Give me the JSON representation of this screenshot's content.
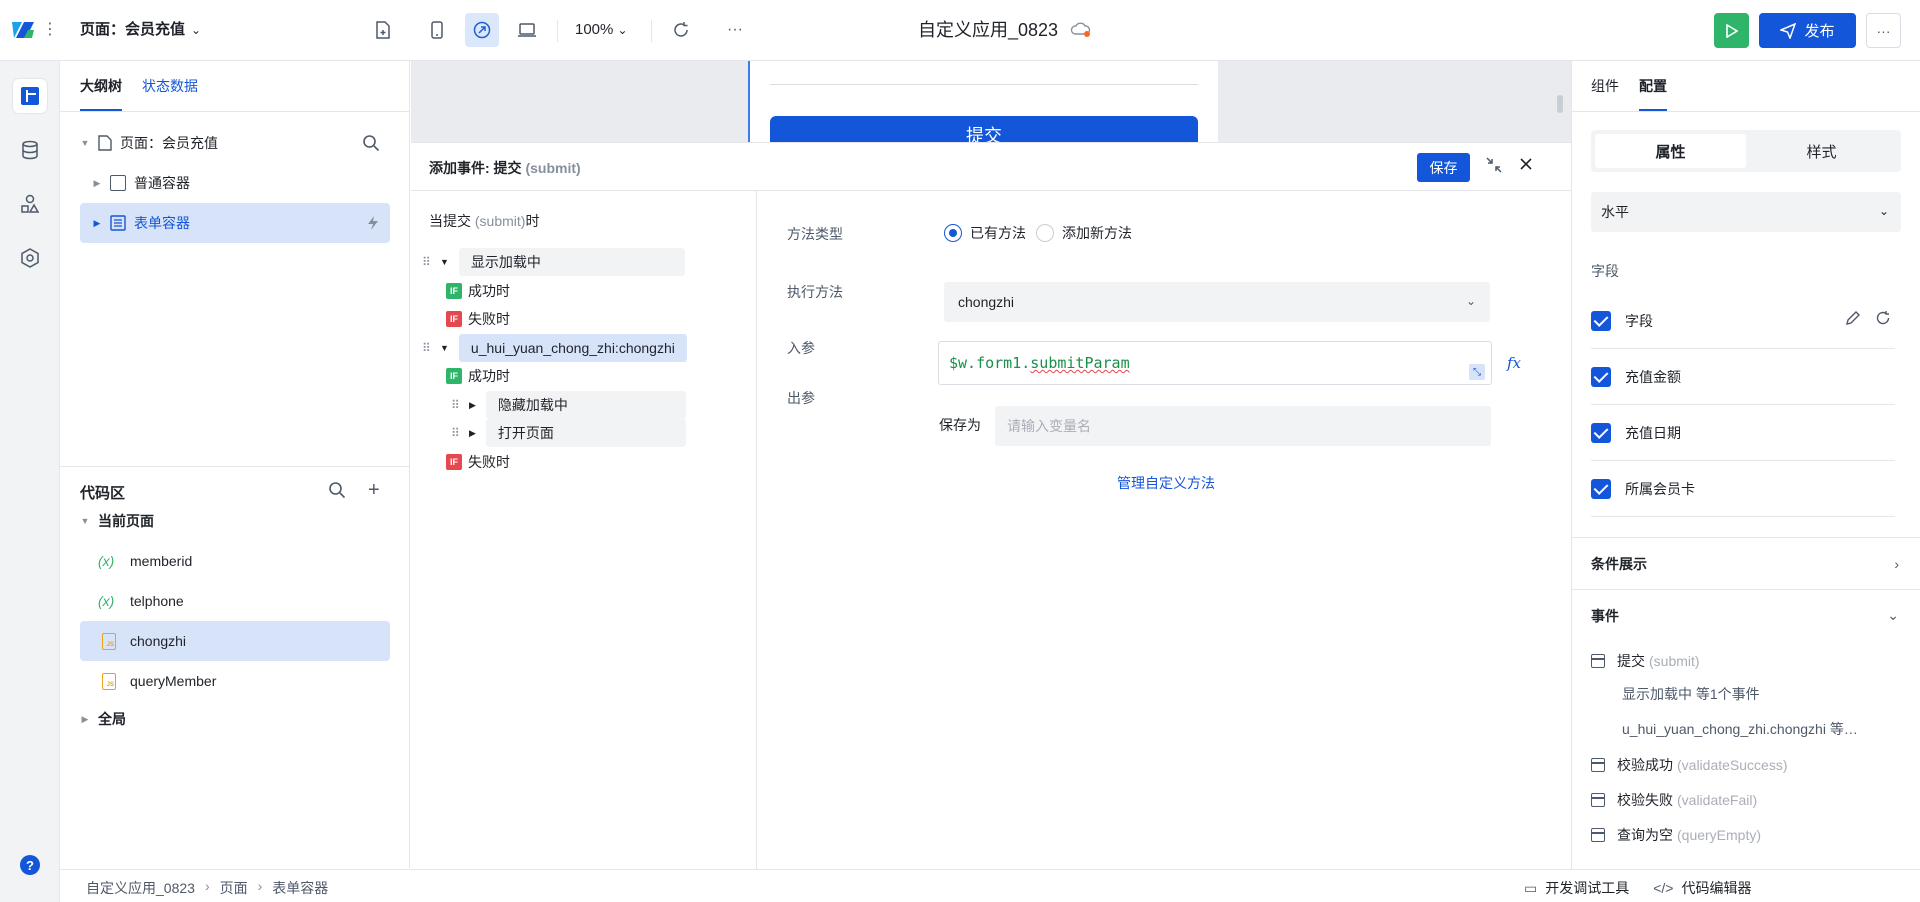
{
  "topbar": {
    "page_label": "页面：会员充值",
    "zoom": "100%",
    "app_title": "自定义应用_0823",
    "publish_label": "发布",
    "more_label": "···"
  },
  "outline": {
    "tabs": [
      "大纲树",
      "状态数据"
    ],
    "tree": [
      {
        "label": "页面：会员充值"
      },
      {
        "label": "普通容器"
      },
      {
        "label": "表单容器"
      }
    ]
  },
  "code": {
    "title": "代码区",
    "groups": {
      "current": "当前页面",
      "global": "全局"
    },
    "items": [
      {
        "icon": "(x)",
        "label": "memberid"
      },
      {
        "icon": "(x)",
        "label": "telphone"
      },
      {
        "icon": "js",
        "label": "chongzhi"
      },
      {
        "icon": "js",
        "label": "queryMember"
      }
    ]
  },
  "canvas": {
    "submit_button": "提交"
  },
  "dialog": {
    "title_prefix": "添加事件: 提交 ",
    "title_event": "(submit)",
    "save_label": "保存",
    "trigger_prefix": "当提交 ",
    "trigger_event": "(submit)",
    "trigger_suffix": "时",
    "actions": {
      "show_loading": "显示加载中",
      "success": "成功时",
      "fail": "失败时",
      "method": "u_hui_yuan_chong_zhi:chongzhi",
      "hide_loading": "隐藏加载中",
      "open_page": "打开页面",
      "if_tag": "IF"
    },
    "form": {
      "method_type_label": "方法类型",
      "radio_existing": "已有方法",
      "radio_new": "添加新方法",
      "exec_label": "执行方法",
      "exec_value": "chongzhi",
      "input_label": "入参",
      "input_value_prefix": "$w.form1.",
      "input_value_err": "submitParam",
      "fx": "fx",
      "output_label": "出参",
      "save_as": "保存为",
      "save_as_placeholder": "请输入变量名",
      "manage_link": "管理自定义方法"
    }
  },
  "props": {
    "tabs": [
      "组件",
      "配置"
    ],
    "seg": [
      "属性",
      "样式"
    ],
    "layout_value": "水平",
    "fields_label": "字段",
    "fields": [
      "字段",
      "充值金额",
      "充值日期",
      "所属会员卡"
    ],
    "cond_display": "条件展示",
    "events_label": "事件",
    "events": [
      {
        "name": "提交",
        "code": "(submit)"
      },
      {
        "name": "校验成功",
        "code": "(validateSuccess)"
      },
      {
        "name": "校验失败",
        "code": "(validateFail)"
      },
      {
        "name": "查询为空",
        "code": "(queryEmpty)"
      }
    ],
    "event_subs": [
      "显示加载中 等1个事件",
      "u_hui_yuan_chong_zhi.chongzhi 等…"
    ]
  },
  "statusbar": {
    "crumbs": [
      "自定义应用_0823",
      "页面",
      "表单容器"
    ],
    "dev_tools": "开发调试工具",
    "code_editor": "代码编辑器"
  },
  "colors": {
    "primary": "#1456d9",
    "success": "#2fb56a",
    "danger": "#e5484d",
    "selected_bg": "#d7e3f9"
  }
}
